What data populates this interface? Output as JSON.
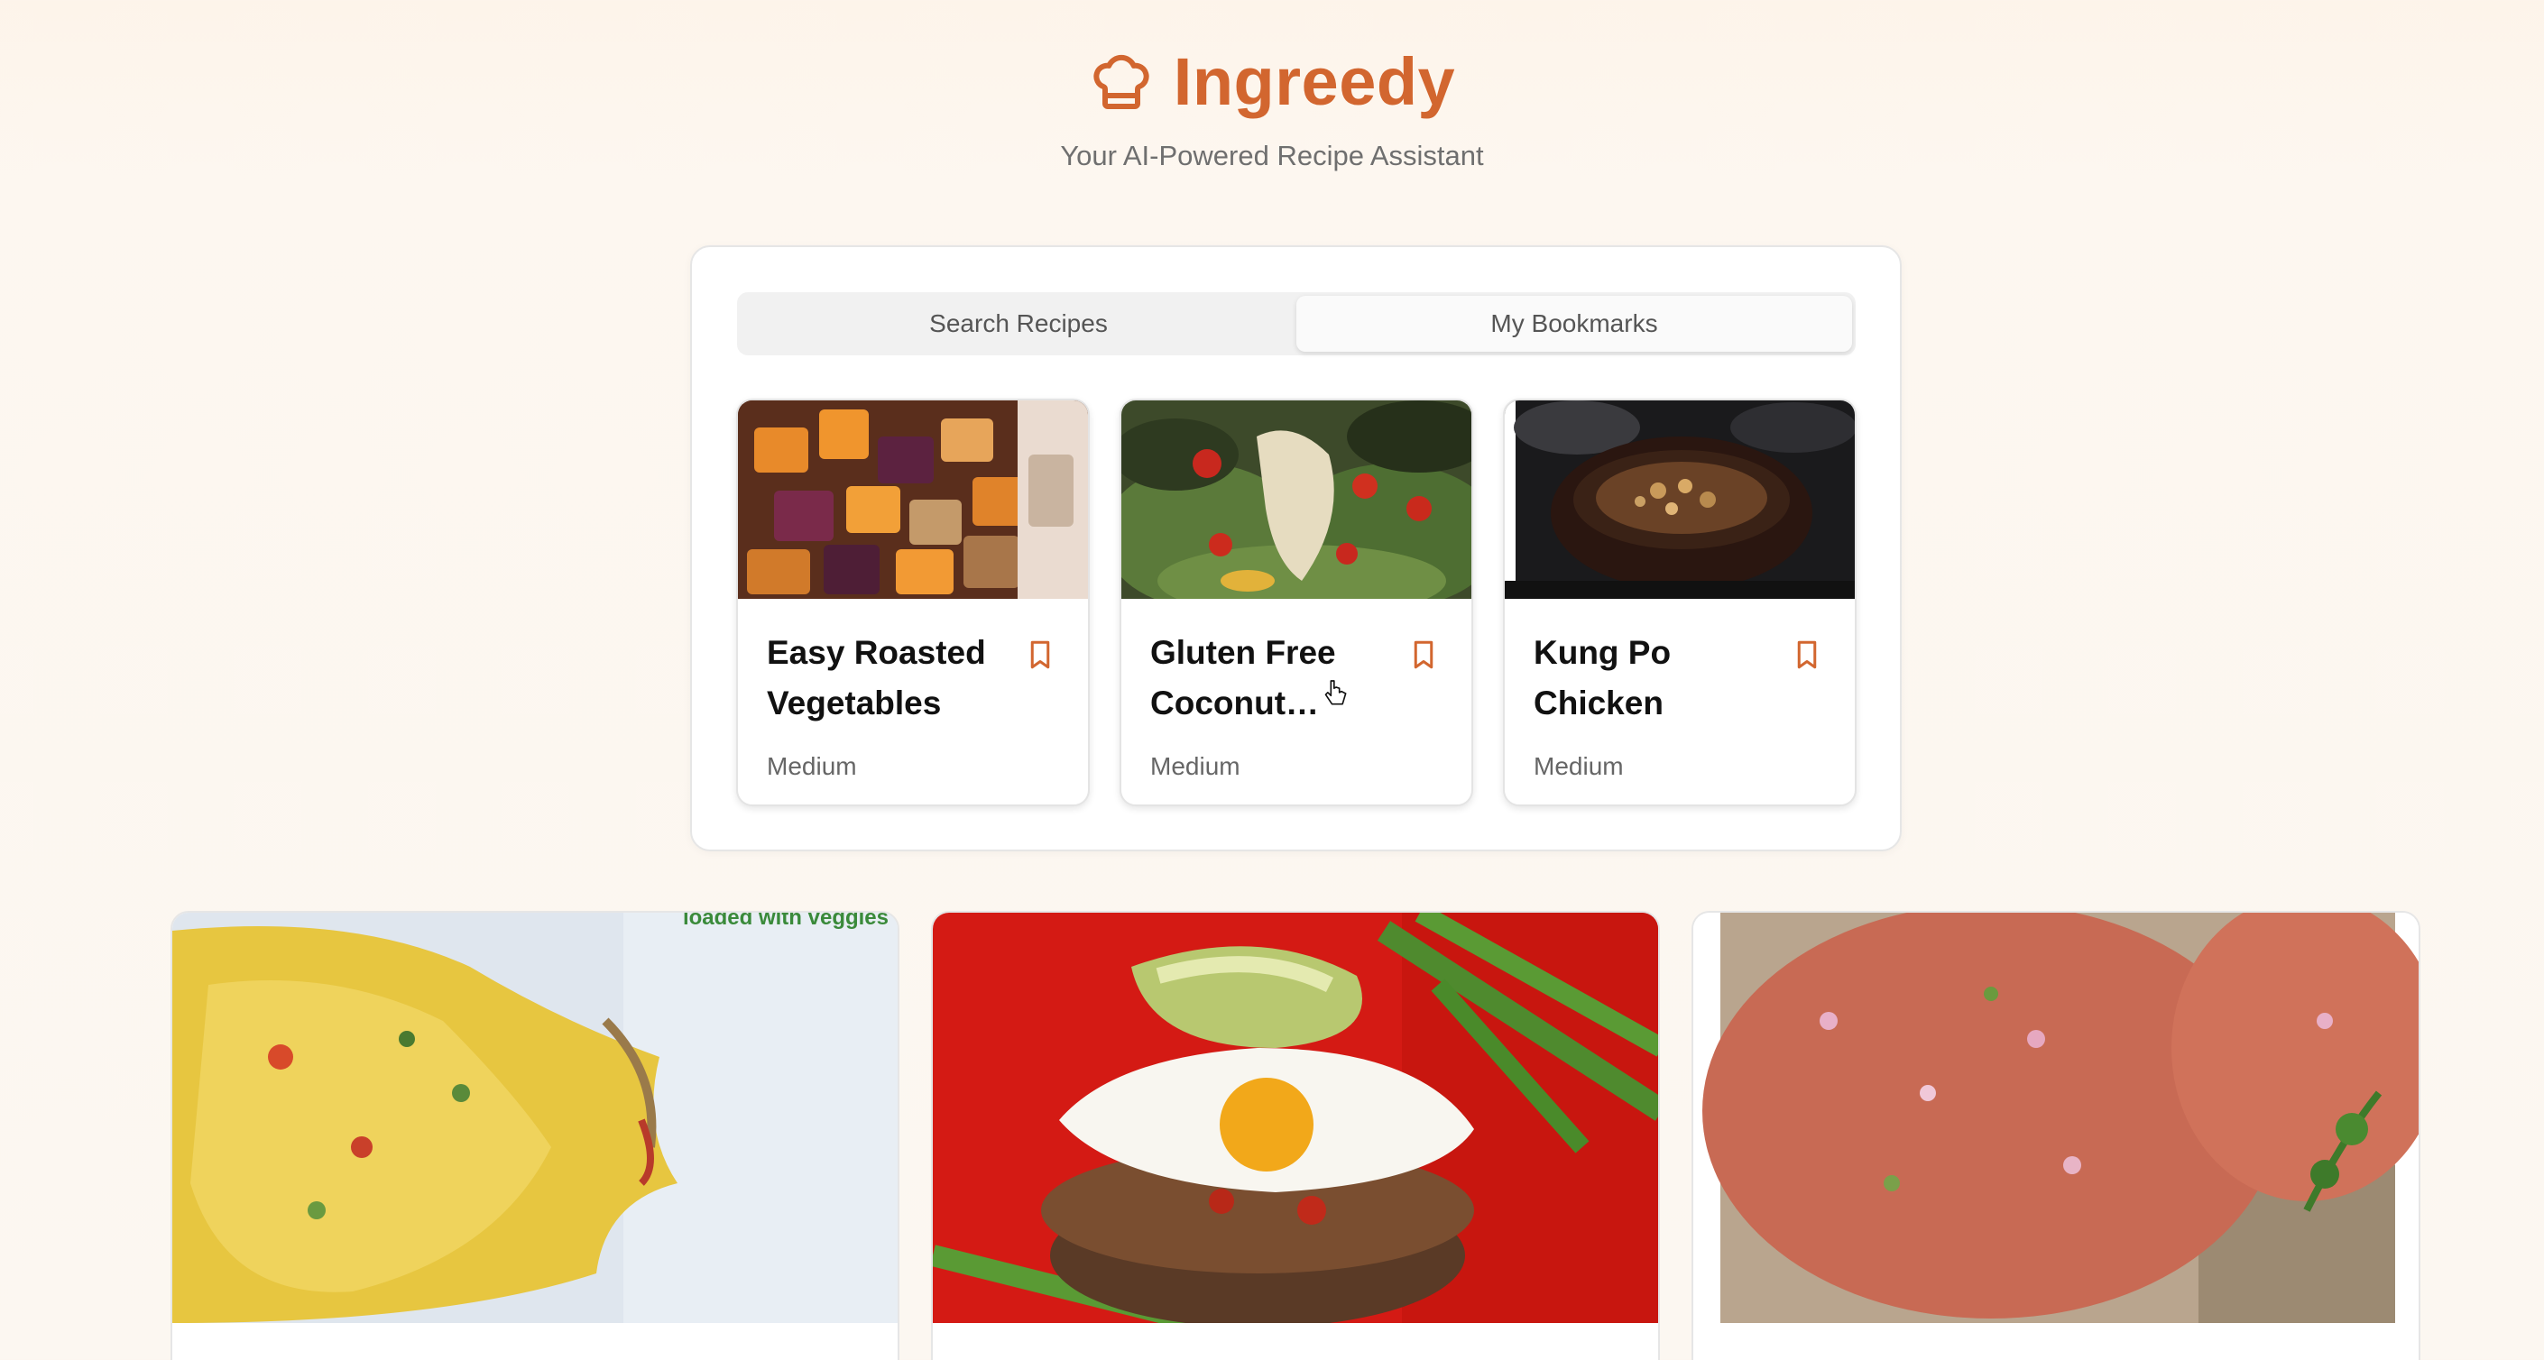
{
  "app": {
    "title": "Ingreedy",
    "tagline": "Your AI-Powered Recipe Assistant",
    "logo_icon": "chef-hat-icon",
    "accent": "#d2662f"
  },
  "tabs": [
    {
      "label": "Search Recipes",
      "active": false
    },
    {
      "label": "My Bookmarks",
      "active": true
    }
  ],
  "bookmarks": [
    {
      "title": "Easy Roasted Vegetables",
      "difficulty": "Medium",
      "image": "roasted-vegetables-photo",
      "icon": "bookmark-icon"
    },
    {
      "title": "Gluten Free Coconut Chick…",
      "difficulty": "Medium",
      "image": "salad-with-chicken-photo",
      "icon": "bookmark-icon"
    },
    {
      "title": "Kung Po Chicken",
      "difficulty": "Medium",
      "image": "noodle-bowl-photo",
      "icon": "bookmark-icon"
    }
  ],
  "recipe_images": [
    {
      "image": "egg-muffin-photo",
      "overlay_text": "loaded with veggies"
    },
    {
      "image": "burger-with-egg-photo"
    },
    {
      "image": "salmon-patties-photo"
    }
  ]
}
